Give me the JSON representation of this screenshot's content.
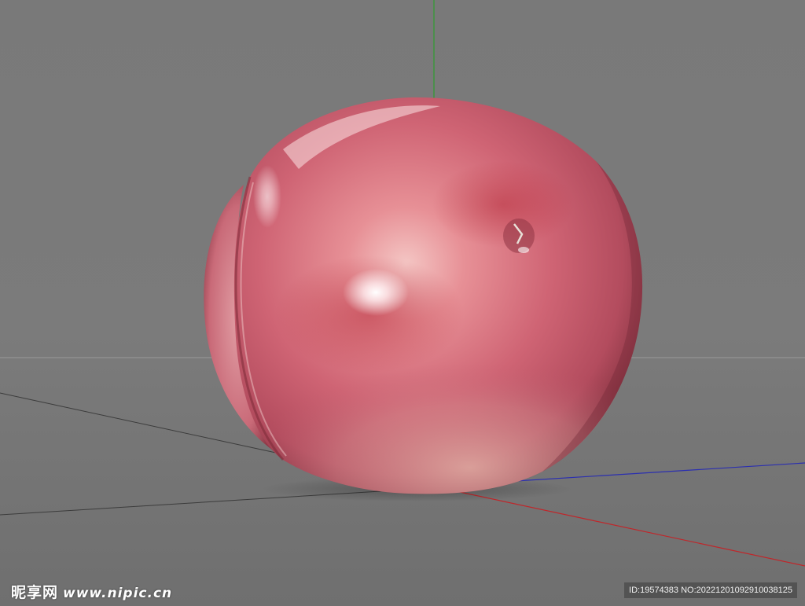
{
  "scene": {
    "subject": "apple",
    "background_color": "#7a7a7a",
    "axis_colors": {
      "y_axis": "#2e9c2e",
      "x_axis": "#c0262a",
      "z_axis": "#2b2fb0",
      "grid": "#3c3c3c",
      "horizon": "#9a9a9a"
    },
    "apple_colors": {
      "base": "#c9646f",
      "light": "#e8a4a8",
      "dark": "#9a3848",
      "highlight": "#ffffff"
    }
  },
  "watermark": {
    "brand": "昵享网",
    "site": "www.nipic.cn"
  },
  "id_strip": {
    "text": "ID:19574383 NO:20221201092910038125"
  }
}
